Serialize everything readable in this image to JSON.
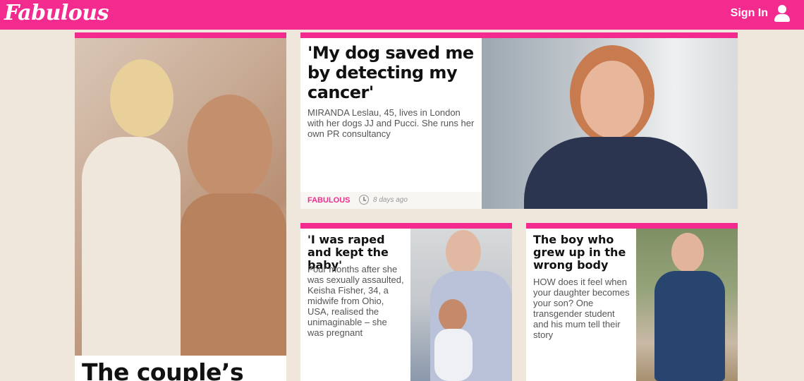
{
  "header": {
    "logo": "Fabulous",
    "signin_label": "Sign In",
    "brand_color": "#f32b8f"
  },
  "cards": {
    "left": {
      "headline": "The couple’s"
    },
    "top": {
      "headline": "'My dog saved me by detecting my cancer'",
      "standfirst": "MIRANDA Leslau, 45, lives in London with her dogs JJ and Pucci. She runs her own PR consultancy",
      "section": "FABULOUS",
      "time": "8 days ago"
    },
    "mid": {
      "headline": "'I was raped and kept the baby'",
      "standfirst": "Four months after she was sexually assaulted, Keisha Fisher, 34, a midwife from Ohio, USA, realised the unimaginable – she was pregnant"
    },
    "right": {
      "headline": "The boy who grew up in the wrong body",
      "standfirst": "HOW does it feel when your daughter becomes your son? One transgender student and his mum tell their story"
    }
  }
}
